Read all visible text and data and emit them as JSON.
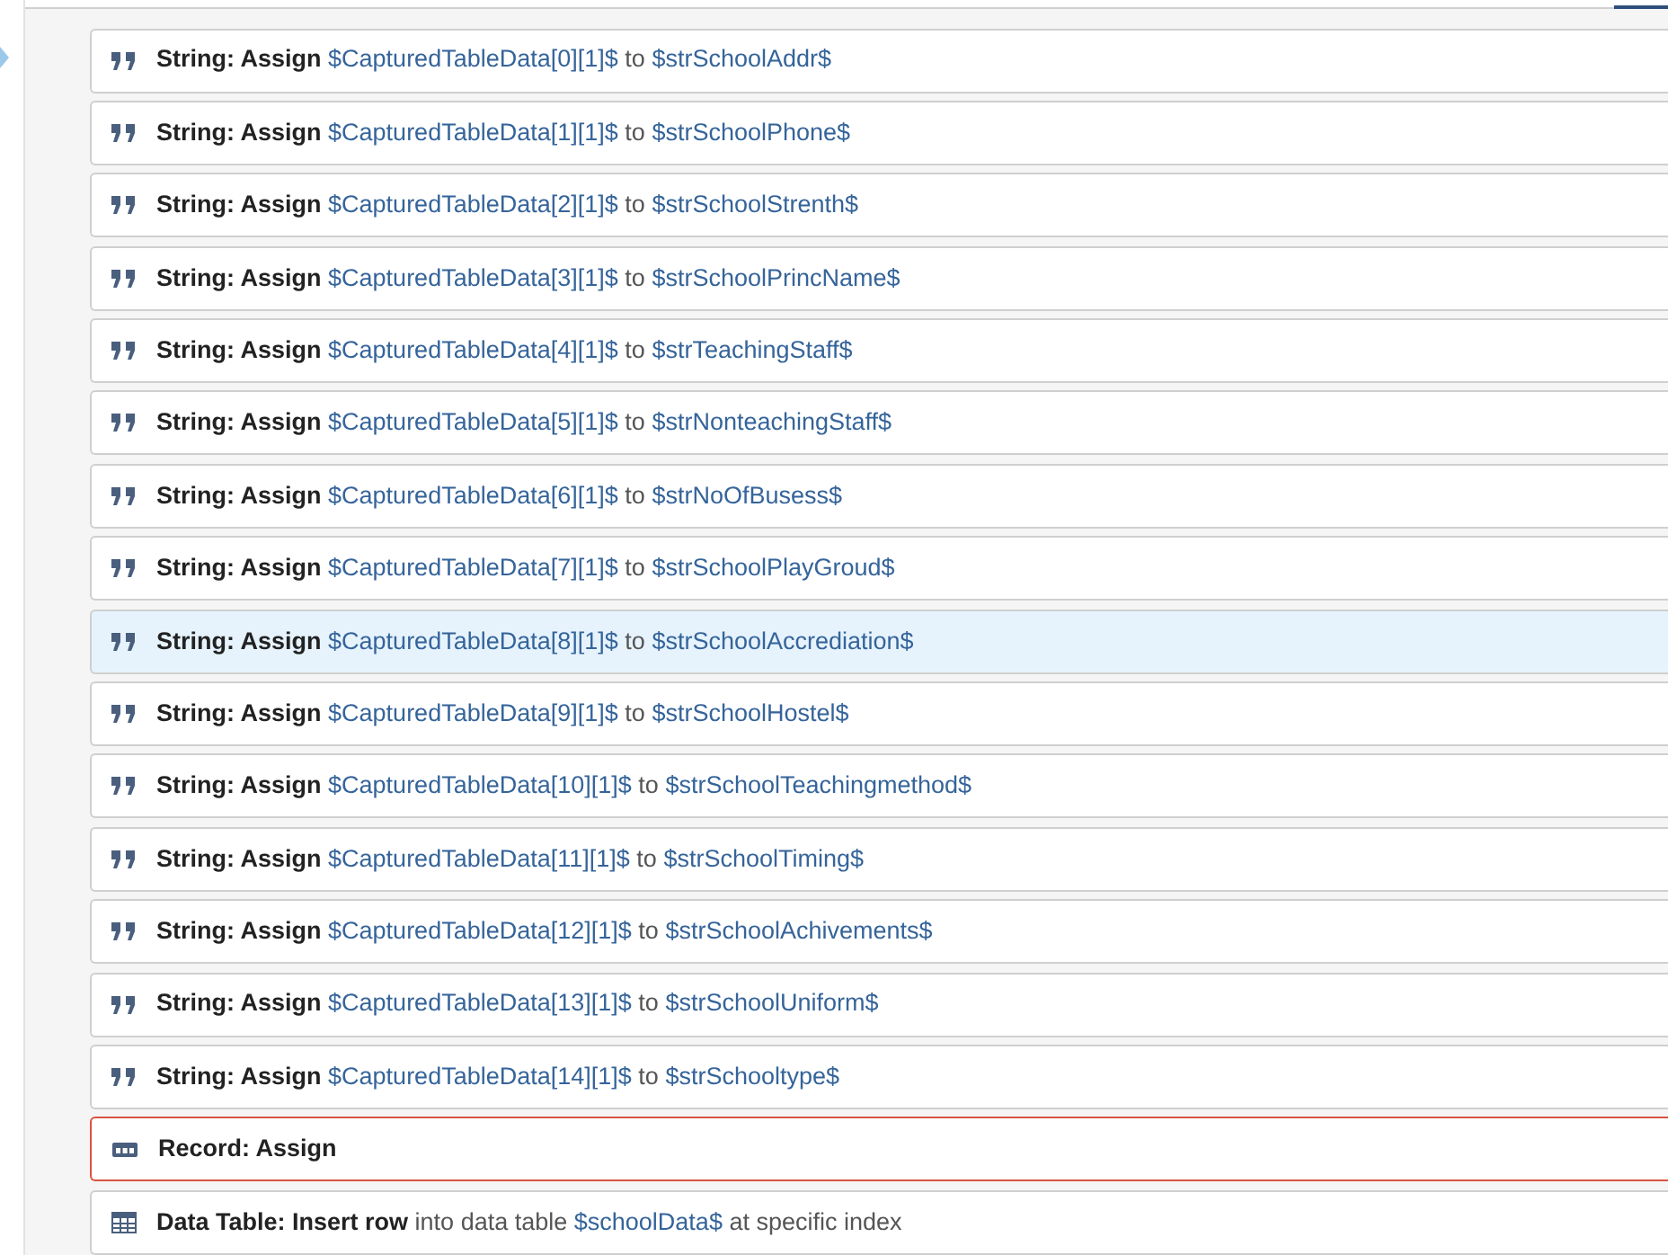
{
  "steps": [
    {
      "kind": "string",
      "selected": false,
      "error": false,
      "parts": [
        {
          "kind": "action",
          "text": "String: Assign"
        },
        {
          "kind": "variable",
          "text": "$CapturedTableData[0][1]$"
        },
        {
          "kind": "word",
          "text": "to"
        },
        {
          "kind": "variable",
          "text": "$strSchoolAddr$"
        }
      ]
    },
    {
      "kind": "string",
      "selected": false,
      "error": false,
      "parts": [
        {
          "kind": "action",
          "text": "String: Assign"
        },
        {
          "kind": "variable",
          "text": "$CapturedTableData[1][1]$"
        },
        {
          "kind": "word",
          "text": "to"
        },
        {
          "kind": "variable",
          "text": "$strSchoolPhone$"
        }
      ]
    },
    {
      "kind": "string",
      "selected": false,
      "error": false,
      "parts": [
        {
          "kind": "action",
          "text": "String: Assign"
        },
        {
          "kind": "variable",
          "text": "$CapturedTableData[2][1]$"
        },
        {
          "kind": "word",
          "text": "to"
        },
        {
          "kind": "variable",
          "text": "$strSchoolStrenth$"
        }
      ]
    },
    {
      "kind": "string",
      "selected": false,
      "error": false,
      "parts": [
        {
          "kind": "action",
          "text": "String: Assign"
        },
        {
          "kind": "variable",
          "text": "$CapturedTableData[3][1]$"
        },
        {
          "kind": "word",
          "text": "to"
        },
        {
          "kind": "variable",
          "text": "$strSchoolPrincName$"
        }
      ]
    },
    {
      "kind": "string",
      "selected": false,
      "error": false,
      "parts": [
        {
          "kind": "action",
          "text": "String: Assign"
        },
        {
          "kind": "variable",
          "text": "$CapturedTableData[4][1]$"
        },
        {
          "kind": "word",
          "text": "to"
        },
        {
          "kind": "variable",
          "text": "$strTeachingStaff$"
        }
      ]
    },
    {
      "kind": "string",
      "selected": false,
      "error": false,
      "parts": [
        {
          "kind": "action",
          "text": "String: Assign"
        },
        {
          "kind": "variable",
          "text": "$CapturedTableData[5][1]$"
        },
        {
          "kind": "word",
          "text": "to"
        },
        {
          "kind": "variable",
          "text": "$strNonteachingStaff$"
        }
      ]
    },
    {
      "kind": "string",
      "selected": false,
      "error": false,
      "parts": [
        {
          "kind": "action",
          "text": "String: Assign"
        },
        {
          "kind": "variable",
          "text": "$CapturedTableData[6][1]$"
        },
        {
          "kind": "word",
          "text": "to"
        },
        {
          "kind": "variable",
          "text": "$strNoOfBusess$"
        }
      ]
    },
    {
      "kind": "string",
      "selected": false,
      "error": false,
      "parts": [
        {
          "kind": "action",
          "text": "String: Assign"
        },
        {
          "kind": "variable",
          "text": "$CapturedTableData[7][1]$"
        },
        {
          "kind": "word",
          "text": "to"
        },
        {
          "kind": "variable",
          "text": "$strSchoolPlayGroud$"
        }
      ]
    },
    {
      "kind": "string",
      "selected": true,
      "error": false,
      "parts": [
        {
          "kind": "action",
          "text": "String: Assign"
        },
        {
          "kind": "variable",
          "text": "$CapturedTableData[8][1]$"
        },
        {
          "kind": "word",
          "text": "to"
        },
        {
          "kind": "variable",
          "text": "$strSchoolAccrediation$"
        }
      ]
    },
    {
      "kind": "string",
      "selected": false,
      "error": false,
      "parts": [
        {
          "kind": "action",
          "text": "String: Assign"
        },
        {
          "kind": "variable",
          "text": "$CapturedTableData[9][1]$"
        },
        {
          "kind": "word",
          "text": "to"
        },
        {
          "kind": "variable",
          "text": "$strSchoolHostel$"
        }
      ]
    },
    {
      "kind": "string",
      "selected": false,
      "error": false,
      "parts": [
        {
          "kind": "action",
          "text": "String: Assign"
        },
        {
          "kind": "variable",
          "text": "$CapturedTableData[10][1]$"
        },
        {
          "kind": "word",
          "text": "to"
        },
        {
          "kind": "variable",
          "text": "$strSchoolTeachingmethod$"
        }
      ]
    },
    {
      "kind": "string",
      "selected": false,
      "error": false,
      "parts": [
        {
          "kind": "action",
          "text": "String: Assign"
        },
        {
          "kind": "variable",
          "text": "$CapturedTableData[11][1]$"
        },
        {
          "kind": "word",
          "text": "to"
        },
        {
          "kind": "variable",
          "text": "$strSchoolTiming$"
        }
      ]
    },
    {
      "kind": "string",
      "selected": false,
      "error": false,
      "parts": [
        {
          "kind": "action",
          "text": "String: Assign"
        },
        {
          "kind": "variable",
          "text": "$CapturedTableData[12][1]$"
        },
        {
          "kind": "word",
          "text": "to"
        },
        {
          "kind": "variable",
          "text": "$strSchoolAchivements$"
        }
      ]
    },
    {
      "kind": "string",
      "selected": false,
      "error": false,
      "parts": [
        {
          "kind": "action",
          "text": "String: Assign"
        },
        {
          "kind": "variable",
          "text": "$CapturedTableData[13][1]$"
        },
        {
          "kind": "word",
          "text": "to"
        },
        {
          "kind": "variable",
          "text": "$strSchoolUniform$"
        }
      ]
    },
    {
      "kind": "string",
      "selected": false,
      "error": false,
      "parts": [
        {
          "kind": "action",
          "text": "String: Assign"
        },
        {
          "kind": "variable",
          "text": "$CapturedTableData[14][1]$"
        },
        {
          "kind": "word",
          "text": "to"
        },
        {
          "kind": "variable",
          "text": "$strSchooltype$"
        }
      ]
    },
    {
      "kind": "record",
      "selected": false,
      "error": true,
      "parts": [
        {
          "kind": "action",
          "text": "Record: Assign"
        }
      ]
    },
    {
      "kind": "datatable",
      "selected": false,
      "error": false,
      "parts": [
        {
          "kind": "action",
          "text": "Data Table: Insert row"
        },
        {
          "kind": "word",
          "text": "into data table"
        },
        {
          "kind": "variable",
          "text": "$schoolData$"
        },
        {
          "kind": "word",
          "text": "at specific index"
        }
      ]
    }
  ]
}
